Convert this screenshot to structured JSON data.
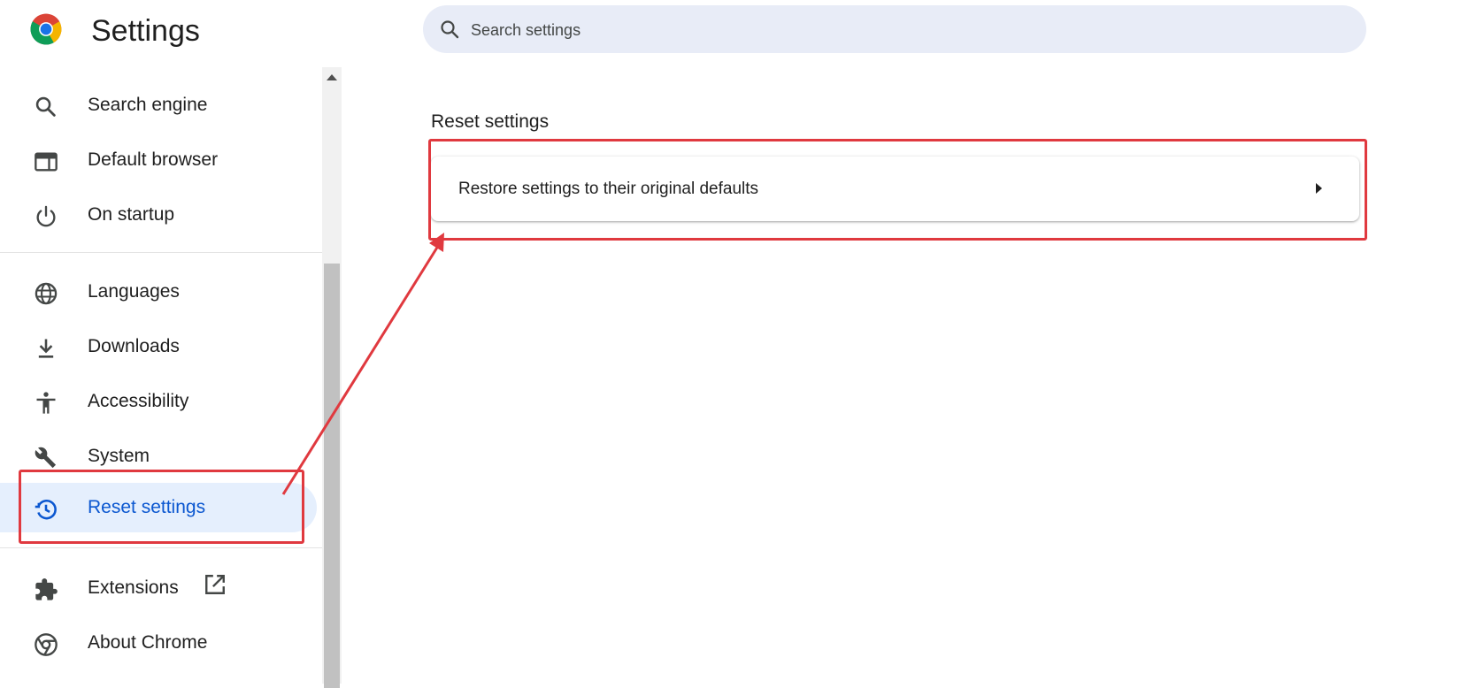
{
  "header": {
    "title": "Settings",
    "logo_icon": "chrome-logo-icon",
    "search": {
      "placeholder": "Search settings",
      "value": ""
    }
  },
  "sidebar": {
    "items": [
      {
        "label": "Search engine",
        "icon": "search-icon"
      },
      {
        "label": "Default browser",
        "icon": "browser-window-icon"
      },
      {
        "label": "On startup",
        "icon": "power-icon"
      },
      {
        "label": "Languages",
        "icon": "globe-icon"
      },
      {
        "label": "Downloads",
        "icon": "download-icon"
      },
      {
        "label": "Accessibility",
        "icon": "accessibility-icon"
      },
      {
        "label": "System",
        "icon": "wrench-icon"
      },
      {
        "label": "Reset settings",
        "icon": "restore-history-icon",
        "active": true
      },
      {
        "label": "Extensions",
        "icon": "puzzle-icon",
        "external_icon": "open-in-new-icon"
      },
      {
        "label": "About Chrome",
        "icon": "chrome-logo-icon"
      }
    ]
  },
  "main": {
    "section_title": "Reset settings",
    "card": {
      "label": "Restore settings to their original defaults",
      "icon": "chevron-right-icon"
    }
  },
  "colors": {
    "accent": "#0b57d0",
    "active_bg": "#e5effd",
    "search_bg": "#e8ecf7",
    "annotation": "#e0393f"
  }
}
